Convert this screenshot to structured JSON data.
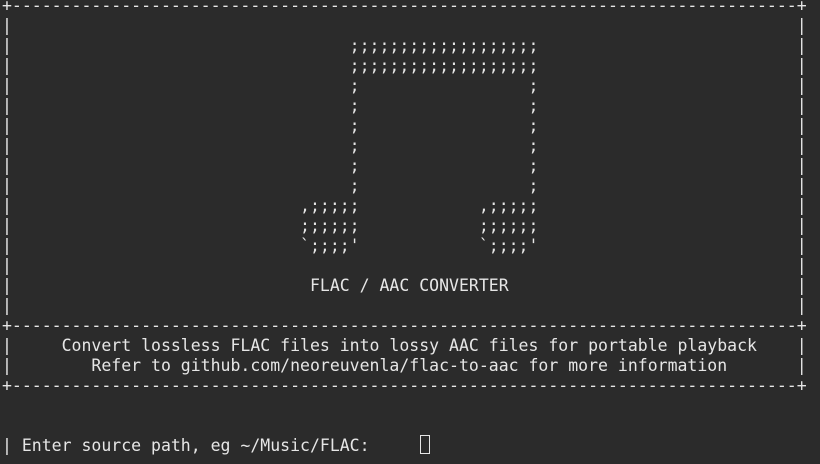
{
  "terminal": {
    "lines": [
      "+-------------------------------------------------------------------------------+",
      "|                                                                               |",
      "|                                  ;;;;;;;;;;;;;;;;;;;                          |",
      "|                                  ;;;;;;;;;;;;;;;;;;;                          |",
      "|                                  ;                 ;                          |",
      "|                                  ;                 ;                          |",
      "|                                  ;                 ;                          |",
      "|                                  ;                 ;                          |",
      "|                                  ;                 ;                          |",
      "|                                  ;                 ;                          |",
      "|                             ,;;;;;            ,;;;;;                          |",
      "|                             ;;;;;;            ;;;;;;                          |",
      "|                             `;;;;'            `;;;;'                          |",
      "|                                                                               |",
      "|                              FLAC / AAC CONVERTER                             |",
      "|                                                                               |",
      "+-------------------------------------------------------------------------------+",
      "|     Convert lossless FLAC files into lossy AAC files for portable playback    |",
      "|        Refer to github.com/neoreuvenla/flac-to-aac for more information       |",
      "+-------------------------------------------------------------------------------+",
      "",
      "",
      "| Enter source path, eg ~/Music/FLAC:"
    ]
  }
}
